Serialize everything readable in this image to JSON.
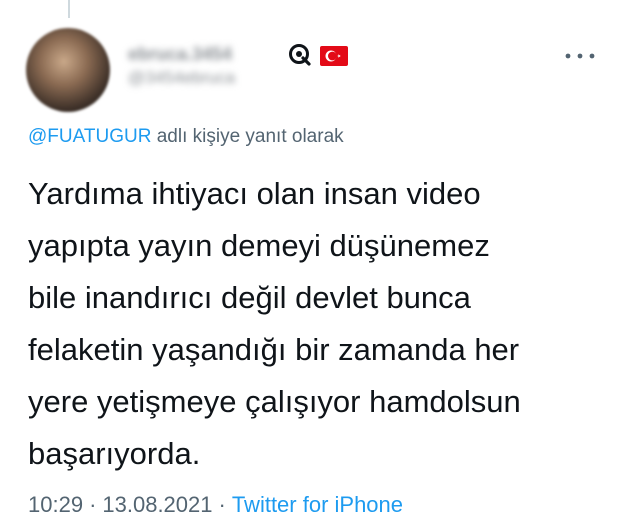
{
  "tweet": {
    "author": {
      "display_name": "ebruca.3454",
      "handle": "@3454ebruca"
    },
    "reply_to": {
      "handle": "@FUATUGUR",
      "suffix": " adlı kişiye yanıt olarak"
    },
    "text_lines": [
      "Yardıma ihtiyacı olan insan video",
      "yapıpta yayın demeyi düşünemez",
      "bile inandırıcı değil devlet bunca",
      "felaketin yaşandığı bir zamanda her",
      "yere yetişmeye çalışıyor hamdolsun",
      "başarıyorda."
    ],
    "time": "10:29",
    "separator": "·",
    "date": "13.08.2021",
    "source": "Twitter for iPhone"
  },
  "icons": {
    "verified": "verified-badge-icon",
    "flag": "turkey-flag-icon",
    "more": "more-options-icon"
  },
  "colors": {
    "link": "#1d9bf0",
    "secondary_text": "#536471",
    "primary_text": "#0f1419",
    "flag_red": "#e30a17"
  }
}
